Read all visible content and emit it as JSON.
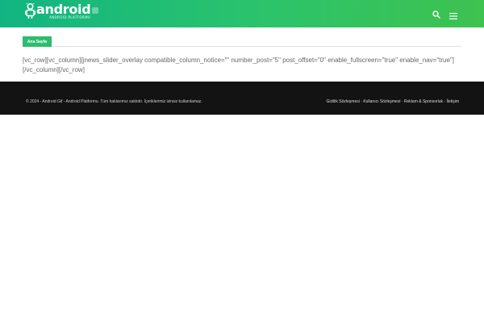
{
  "header": {
    "logo_text": "android",
    "logo_tagline": "ANDROID PLATFORMU",
    "icons": {
      "search": "search-icon",
      "menu": "hamburger-menu-icon",
      "logo": "android-robot-icon"
    }
  },
  "breadcrumb": {
    "home_label": "Ana Sayfa"
  },
  "content": {
    "shortcode_text": "[vc_row][vc_column][jnews_slider_overlay compatible_column_notice=\"\" number_post=\"5\" post_offset=\"0\" enable_fullscreen=\"true\" enable_nav=\"true\"][/vc_column][/vc_row]"
  },
  "footer": {
    "copyright": "© 2024 - Android Gif - Android Platformu. Tüm haklarımız saklıdır. İçeriklerimiz izinsiz kullanılamaz.",
    "links": [
      {
        "label": "Gizlilik Sözleşmesi"
      },
      {
        "label": "Kullanıcı Sözleşmesi"
      },
      {
        "label": "Reklam & Sponsorluk"
      },
      {
        "label": "İletişim"
      }
    ],
    "separator": " - "
  },
  "colors": {
    "header_start": "#12b582",
    "header_end": "#3ec24f",
    "accent": "#2dbd6e",
    "footer_bg": "#131313"
  }
}
